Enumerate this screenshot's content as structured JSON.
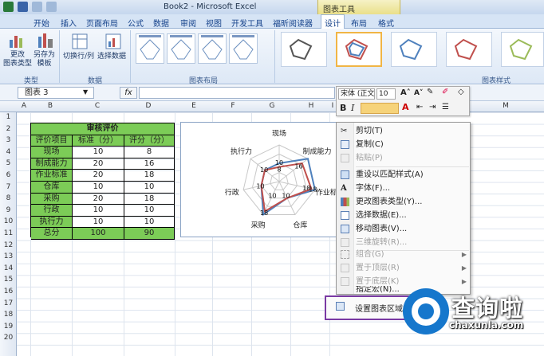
{
  "window": {
    "title": "Book2 - Microsoft Excel",
    "context_tab_group": "图表工具"
  },
  "ribbon_tabs": [
    "开始",
    "插入",
    "页面布局",
    "公式",
    "数据",
    "审阅",
    "视图",
    "开发工具",
    "福昕阅读器",
    "设计",
    "布局",
    "格式"
  ],
  "ribbon": {
    "type_group": {
      "label": "类型",
      "change_type": "更改\n图表类型",
      "save_template": "另存为\n模板"
    },
    "data_group": {
      "label": "数据",
      "switch_row_col": "切换行/列",
      "select_data": "选择数据"
    },
    "layout_group": {
      "label": "图表布局"
    },
    "style_group": {
      "label": "图表样式"
    }
  },
  "formula_bar": {
    "name_box": "图表 3",
    "fx": "fx"
  },
  "columns": [
    "A",
    "B",
    "C",
    "D",
    "E",
    "F",
    "G",
    "H",
    "I",
    "M"
  ],
  "rows": [
    "1",
    "2",
    "3",
    "4",
    "5",
    "6",
    "7",
    "8",
    "9",
    "10",
    "11",
    "12",
    "13",
    "14",
    "15",
    "16",
    "17",
    "18",
    "19",
    "20"
  ],
  "table": {
    "title": "审核评价",
    "headers": [
      "评价项目",
      "标准（分）",
      "评分（分）"
    ],
    "rows": [
      [
        "现场",
        "10",
        "8"
      ],
      [
        "制成能力",
        "20",
        "16"
      ],
      [
        "作业标准",
        "20",
        "18"
      ],
      [
        "仓库",
        "10",
        "10"
      ],
      [
        "采购",
        "20",
        "18"
      ],
      [
        "行政",
        "10",
        "10"
      ],
      [
        "执行力",
        "10",
        "10"
      ],
      [
        "总分",
        "100",
        "90"
      ]
    ]
  },
  "chart_data": {
    "type": "radar",
    "categories": [
      "现场",
      "制成能力",
      "作业标准",
      "仓库",
      "采购",
      "行政",
      "执行力"
    ],
    "series": [
      {
        "values": [
          10,
          20,
          20,
          10,
          20,
          10,
          10
        ],
        "color": "#4f81bd"
      },
      {
        "values": [
          8,
          16,
          18,
          10,
          18,
          10,
          10
        ],
        "color": "#c0504d"
      }
    ],
    "category_labels_visible": [
      "现场",
      "制成能力",
      "作业标",
      "仓库",
      "采购",
      "行政",
      "执行力"
    ],
    "data_labels": [
      "8",
      "10",
      "16",
      "18",
      "10",
      "18",
      "10",
      "10",
      "18",
      "10"
    ],
    "rmax": 20
  },
  "mini_toolbar": {
    "font": "宋体 (正文",
    "size": "10",
    "bold": "B",
    "italic": "I"
  },
  "context_menu": {
    "items": [
      {
        "label": "剪切(T)",
        "disabled": false,
        "icon": "cut-icon"
      },
      {
        "label": "复制(C)",
        "disabled": false,
        "icon": "copy-icon"
      },
      {
        "label": "粘贴(P)",
        "disabled": true,
        "icon": "paste-icon"
      },
      {
        "label": "重设以匹配样式(A)",
        "disabled": false,
        "icon": "reset-style-icon"
      },
      {
        "label": "字体(F)...",
        "disabled": false,
        "icon": "font-icon"
      },
      {
        "label": "更改图表类型(Y)...",
        "disabled": false,
        "icon": "chart-type-icon"
      },
      {
        "label": "选择数据(E)...",
        "disabled": false,
        "icon": "select-data-icon"
      },
      {
        "label": "移动图表(V)...",
        "disabled": false,
        "icon": "move-chart-icon"
      },
      {
        "label": "三维旋转(R)...",
        "disabled": true,
        "icon": "3d-rotate-icon"
      },
      {
        "label": "组合(G)",
        "disabled": true,
        "icon": "group-icon",
        "submenu": true
      },
      {
        "label": "置于顶层(R)",
        "disabled": true,
        "icon": "bring-front-icon",
        "submenu": true
      },
      {
        "label": "置于底层(K)",
        "disabled": true,
        "icon": "send-back-icon",
        "submenu": true
      },
      {
        "label": "指定宏(N)...",
        "disabled": false,
        "icon": "macro-icon"
      },
      {
        "label": "设置图表区域格式",
        "disabled": false,
        "icon": "format-area-icon"
      }
    ]
  },
  "watermark": {
    "brand": "查询啦",
    "url": "chaxunla.com"
  }
}
